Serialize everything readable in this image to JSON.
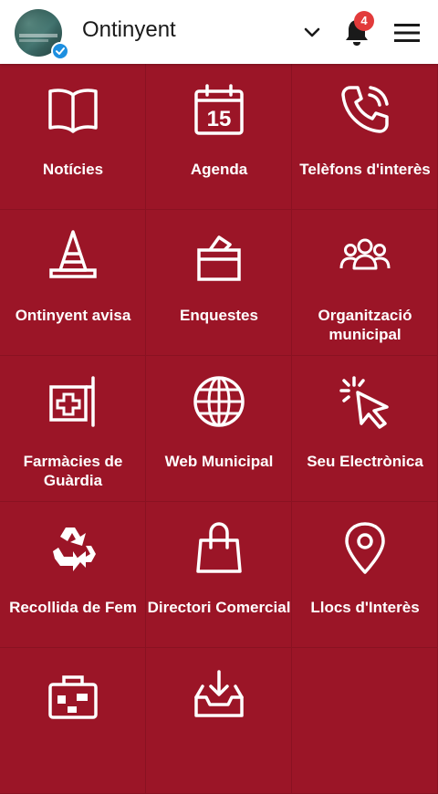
{
  "header": {
    "title": "Ontinyent",
    "notification_count": "4"
  },
  "tiles": [
    {
      "label": "Notícies",
      "icon": "book-icon"
    },
    {
      "label": "Agenda",
      "icon": "calendar-icon",
      "icon_text": "15"
    },
    {
      "label": "Telèfons d'interès",
      "icon": "phone-icon"
    },
    {
      "label": "Ontinyent avisa",
      "icon": "traffic-cone-icon"
    },
    {
      "label": "Enquestes",
      "icon": "ballot-box-icon"
    },
    {
      "label": "Organització municipal",
      "icon": "people-group-icon"
    },
    {
      "label": "Farmàcies de Guàrdia",
      "icon": "pharmacy-sign-icon"
    },
    {
      "label": "Web Municipal",
      "icon": "globe-icon"
    },
    {
      "label": "Seu Electrònica",
      "icon": "cursor-click-icon"
    },
    {
      "label": "Recollida de Fem",
      "icon": "recycle-icon"
    },
    {
      "label": "Directori Comercial",
      "icon": "shopping-bag-icon"
    },
    {
      "label": "Llocs d'Interès",
      "icon": "map-pin-icon"
    },
    {
      "label": "",
      "icon": "suitcase-icon"
    },
    {
      "label": "",
      "icon": "download-tray-icon"
    },
    {
      "label": "",
      "icon": ""
    }
  ],
  "colors": {
    "accent": "#9b1527",
    "badge": "#e23b3b",
    "verified": "#1d8fe0"
  }
}
